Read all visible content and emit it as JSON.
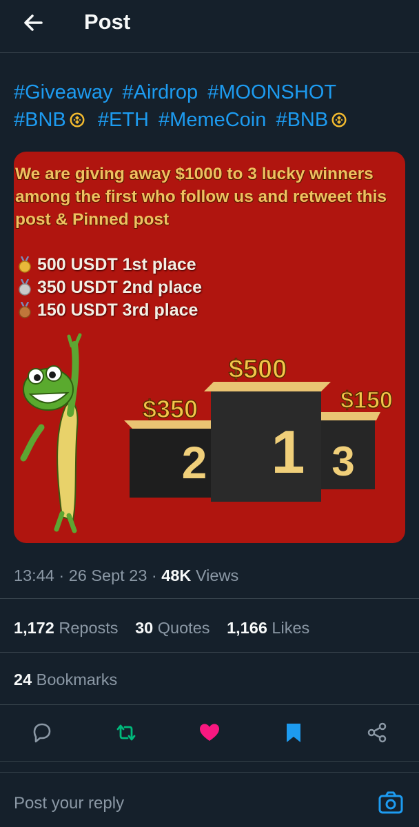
{
  "header": {
    "title": "Post"
  },
  "post": {
    "hashtags_line1": [
      "#Giveaway",
      "#Airdrop",
      "#MOONSHOT"
    ],
    "hashtags_line2": [
      "#BNB",
      "#ETH",
      "#MemeCoin",
      "#BNB"
    ],
    "image": {
      "promo_text": "We are giving away $1000 to 3 lucky winners among the first who follow us and retweet this post & Pinned post",
      "prizes": [
        "500 USDT 1st place",
        "350 USDT 2nd place",
        "150 USDT 3rd place"
      ],
      "podium": {
        "first_amount": "$500",
        "first_rank": "1",
        "second_amount": "$350",
        "second_rank": "2",
        "third_amount": "$150",
        "third_rank": "3"
      }
    },
    "time": "13:44",
    "date": "26 Sept 23",
    "views_count": "48K",
    "views_label": "Views",
    "separator": "·"
  },
  "stats": {
    "reposts_count": "1,172",
    "reposts_label": "Reposts",
    "quotes_count": "30",
    "quotes_label": "Quotes",
    "likes_count": "1,166",
    "likes_label": "Likes",
    "bookmarks_count": "24",
    "bookmarks_label": "Bookmarks"
  },
  "reply": {
    "placeholder": "Post your reply"
  },
  "icons": {
    "back": "arrow-left-icon",
    "reply": "speech-bubble-icon",
    "repost": "repost-icon",
    "like": "heart-icon",
    "bookmark": "bookmark-icon",
    "share": "share-icon",
    "camera": "camera-icon"
  },
  "colors": {
    "background": "#15202b",
    "accent": "#1d9bf0",
    "muted": "#8b98a5",
    "repost_active": "#00ba7c",
    "like_active": "#f91880",
    "bookmark_active": "#1d9bf0",
    "image_bg": "#b0150f"
  }
}
